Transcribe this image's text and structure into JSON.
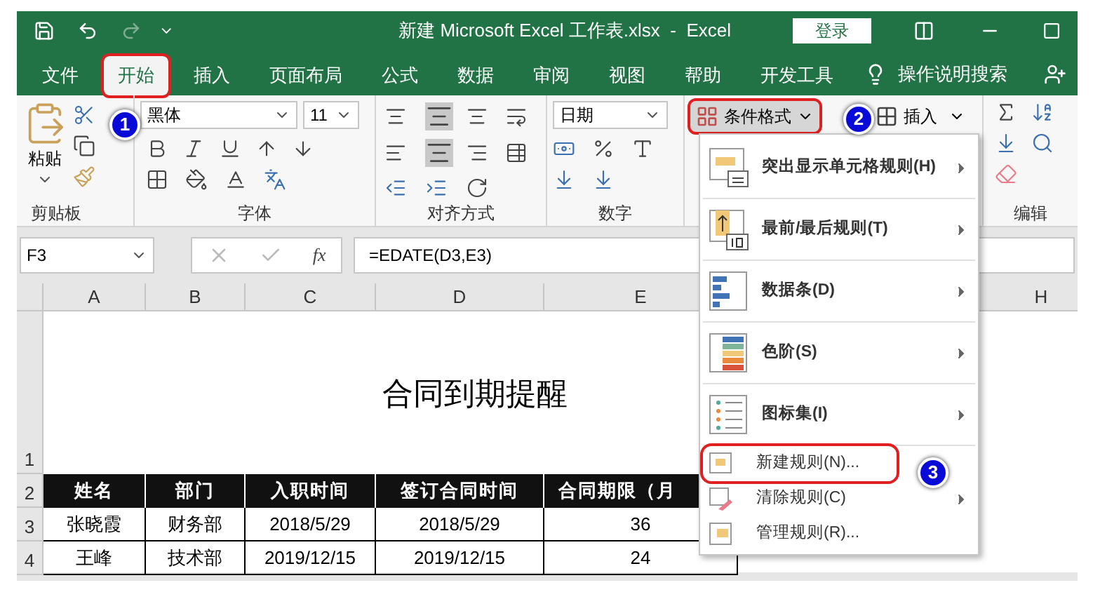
{
  "window": {
    "title": "新建 Microsoft Excel 工作表.xlsx  -  Excel",
    "login": "登录"
  },
  "tabs": [
    {
      "label": "文件",
      "selected": false
    },
    {
      "label": "开始",
      "selected": true
    },
    {
      "label": "插入",
      "selected": false
    },
    {
      "label": "页面布局",
      "selected": false
    },
    {
      "label": "公式",
      "selected": false
    },
    {
      "label": "数据",
      "selected": false
    },
    {
      "label": "审阅",
      "selected": false
    },
    {
      "label": "视图",
      "selected": false
    },
    {
      "label": "帮助",
      "selected": false
    },
    {
      "label": "开发工具",
      "selected": false
    }
  ],
  "search_hint": "操作说明搜索",
  "ribbon": {
    "paste": "粘贴",
    "font_name": "黑体",
    "font_size": "11",
    "number_format": "日期",
    "conditional_format": "条件格式",
    "insert": "插入",
    "groups": [
      "剪贴板",
      "字体",
      "对齐方式",
      "数字",
      "编辑"
    ]
  },
  "formula_bar": {
    "name_box": "F3",
    "fx": "fx",
    "formula": "=EDATE(D3,E3)"
  },
  "sheet": {
    "columns": [
      "A",
      "B",
      "C",
      "D",
      "E"
    ],
    "last_column": "H",
    "row_numbers": [
      "1",
      "2",
      "3",
      "4"
    ],
    "title": "合同到期提醒",
    "header": [
      "姓名",
      "部门",
      "入职时间",
      "签订合同时间",
      "合同期限（月"
    ],
    "rows": [
      [
        "张晓霞",
        "财务部",
        "2018/5/29",
        "2018/5/29",
        "36"
      ],
      [
        "王峰",
        "技术部",
        "2019/12/15",
        "2019/12/15",
        "24"
      ]
    ]
  },
  "menu": [
    {
      "label": "突出显示单元格规则(H)",
      "kind": "highlight",
      "submenu": true,
      "marked": false
    },
    {
      "label": "最前/最后规则(T)",
      "kind": "top",
      "submenu": true,
      "marked": false
    },
    {
      "label": "数据条(D)",
      "kind": "databar",
      "submenu": true,
      "marked": false
    },
    {
      "label": "色阶(S)",
      "kind": "scale",
      "submenu": true,
      "marked": false
    },
    {
      "label": "图标集(I)",
      "kind": "iconset",
      "submenu": true,
      "marked": false
    },
    {
      "label": "新建规则(N)...",
      "kind": "new",
      "submenu": false,
      "marked": true
    },
    {
      "label": "清除规则(C)",
      "kind": "clear",
      "submenu": true,
      "marked": false
    },
    {
      "label": "管理规则(R)...",
      "kind": "manage",
      "submenu": false,
      "marked": false
    }
  ],
  "callouts": [
    "1",
    "2",
    "3"
  ]
}
